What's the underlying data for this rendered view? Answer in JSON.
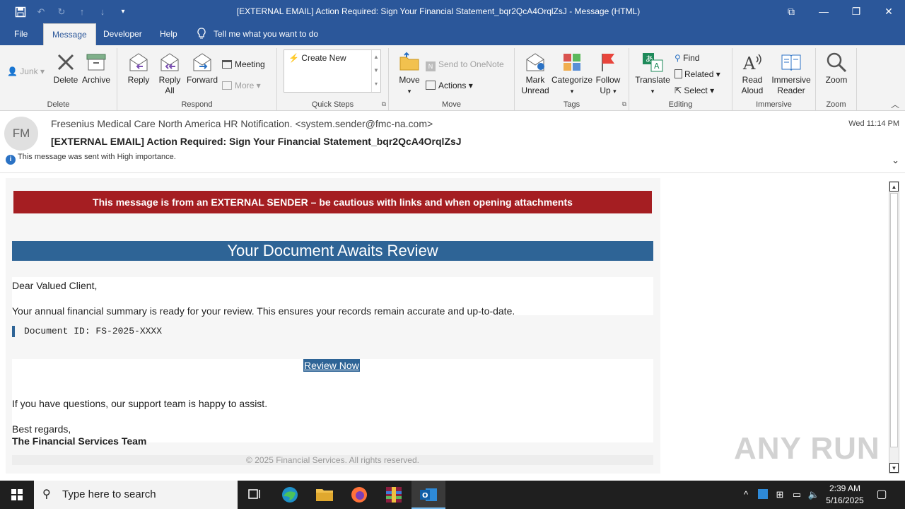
{
  "window": {
    "title": "[EXTERNAL EMAIL] Action Required: Sign Your Financial Statement_bqr2QcA4OrqlZsJ  -  Message (HTML)",
    "controls": {
      "restore_ribbon": "⧉",
      "minimize": "—",
      "maximize": "❐",
      "close": "✕"
    }
  },
  "quick_access": {
    "save": "save-icon",
    "undo": "undo-icon",
    "redo": "redo-icon",
    "up": "up-icon",
    "down": "down-icon",
    "customize": "customize-icon"
  },
  "tabs": [
    {
      "label": "File"
    },
    {
      "label": "Message"
    },
    {
      "label": "Developer"
    },
    {
      "label": "Help"
    }
  ],
  "tell_me": "Tell me what you want to do",
  "ribbon": {
    "delete_group": {
      "label": "Delete",
      "junk": "Junk",
      "delete": "Delete",
      "archive": "Archive"
    },
    "respond_group": {
      "label": "Respond",
      "reply": "Reply",
      "reply_all_1": "Reply",
      "reply_all_2": "All",
      "forward": "Forward",
      "meeting": "Meeting",
      "more": "More"
    },
    "quick_steps_group": {
      "label": "Quick Steps",
      "create_new": "Create New"
    },
    "move_group": {
      "label": "Move",
      "move": "Move",
      "onenote": "Send to OneNote",
      "actions": "Actions"
    },
    "tags_group": {
      "label": "Tags",
      "mark_unread_1": "Mark",
      "mark_unread_2": "Unread",
      "categorize": "Categorize",
      "follow_up_1": "Follow",
      "follow_up_2": "Up"
    },
    "editing_group": {
      "label": "Editing",
      "translate": "Translate",
      "find": "Find",
      "related": "Related",
      "select": "Select"
    },
    "immersive_group": {
      "label": "Immersive",
      "read_aloud_1": "Read",
      "read_aloud_2": "Aloud",
      "immersive_reader_1": "Immersive",
      "immersive_reader_2": "Reader"
    },
    "zoom_group": {
      "label": "Zoom",
      "zoom": "Zoom"
    }
  },
  "message": {
    "avatar": "FM",
    "from": "Fresenius Medical Care North America HR Notification. <system.sender@fmc-na.com>",
    "subject": "[EXTERNAL EMAIL] Action Required: Sign Your Financial Statement_bqr2QcA4OrqlZsJ",
    "date": "Wed 11:14 PM",
    "importance": "This message was sent with High importance."
  },
  "email": {
    "warning": "This message is from an EXTERNAL SENDER – be cautious with links and when opening attachments",
    "banner": "Your Document Awaits Review",
    "greeting": "Dear Valued Client,",
    "para1": "Your annual financial summary is ready for your review. This ensures your records remain accurate and up-to-date.",
    "doc_id": "Document ID: FS-2025-XXXX",
    "cta": "Review Now",
    "para2": "If you have questions, our support team is happy to assist.",
    "signoff": "Best regards,",
    "signature": "The Financial Services Team",
    "footer": "© 2025 Financial Services. All rights reserved."
  },
  "watermark": "ANY RUN",
  "taskbar": {
    "search_placeholder": "Type here to search",
    "time": "2:39 AM",
    "date": "5/16/2025"
  },
  "colors": {
    "title_blue": "#2b579a",
    "warning_red": "#a51e22",
    "banner_blue": "#2e6496"
  }
}
